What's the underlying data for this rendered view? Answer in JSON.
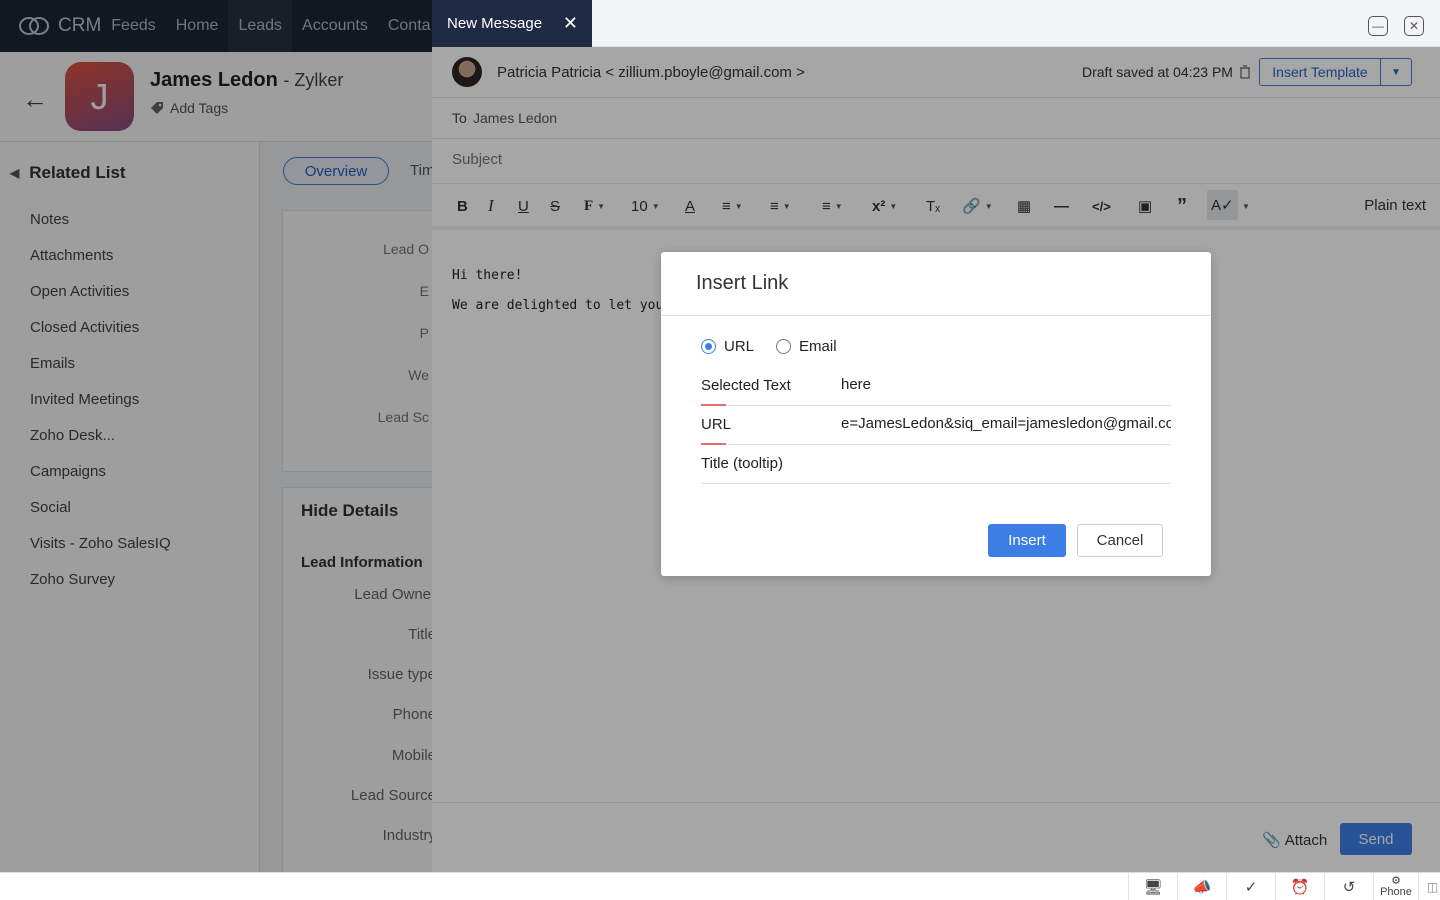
{
  "crm": {
    "logo": "CRM",
    "nav": [
      "Feeds",
      "Home",
      "Leads",
      "Accounts",
      "Conta"
    ],
    "lead_name": "James Ledon",
    "company": "Zylker",
    "add_tags": "Add Tags",
    "avatar_letter": "J",
    "related_title": "Related List",
    "related_items": [
      "Notes",
      "Attachments",
      "Open Activities",
      "Closed Activities",
      "Emails",
      "Invited Meetings",
      "Zoho Desk...",
      "Campaigns",
      "Social",
      "Visits - Zoho SalesIQ",
      "Zoho Survey"
    ],
    "tab_overview": "Overview",
    "tab_timeline": "Tim",
    "card_fields": [
      "Lead O",
      "E",
      "P",
      "We",
      "Lead Sc"
    ],
    "hide_details": "Hide Details",
    "lead_information": "Lead Information",
    "lead_fields": [
      "Lead Owner",
      "Title",
      "Issue type",
      "Phone",
      "Mobile",
      "Lead Source",
      "Industry"
    ]
  },
  "compose": {
    "tab_title": "New Message",
    "from": "Patricia Patricia < zillium.pboyle@gmail.com >",
    "draft_saved": "Draft saved at 04:23 PM",
    "insert_template": "Insert Template",
    "to_label": "To",
    "to_value": "James Ledon",
    "subject_placeholder": "Subject",
    "font_size": "10",
    "plain_text": "Plain text",
    "body_line1": "Hi there!",
    "body_line2": "We are delighted to let you kno",
    "attach": "Attach",
    "send": "Send"
  },
  "dialog": {
    "title": "Insert Link",
    "radio_url": "URL",
    "radio_email": "Email",
    "selected_text_label": "Selected Text",
    "selected_text_value": "here",
    "url_label": "URL",
    "url_value": "e=JamesLedon&siq_email=jamesledon@gmail.com",
    "title_label": "Title (tooltip)",
    "title_value": "",
    "insert": "Insert",
    "cancel": "Cancel"
  },
  "bottombar": {
    "phone": "Phone"
  },
  "colors": {
    "accent": "#3d7ee6",
    "topbar": "#1f2632",
    "compose_tab": "#1f2a44",
    "required_marker": "#e36f6f"
  }
}
